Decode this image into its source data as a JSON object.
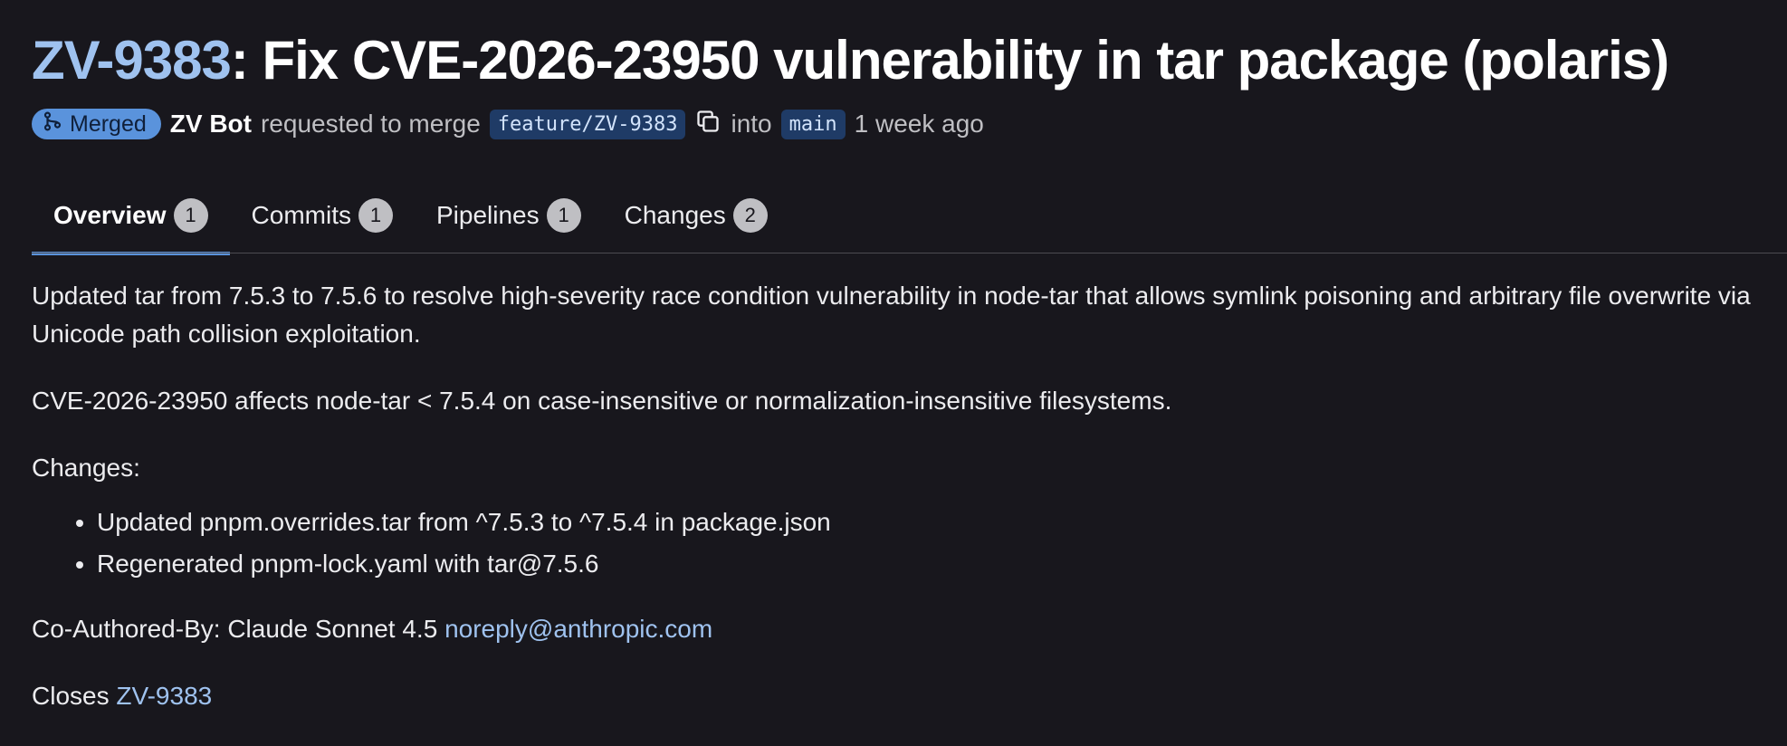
{
  "title": {
    "issue_key": "ZV-9383",
    "text": ": Fix CVE-2026-23950 vulnerability in tar package (polaris)"
  },
  "meta": {
    "status": "Merged",
    "author": "ZV Bot",
    "requested_text": "requested to merge",
    "source_branch": "feature/ZV-9383",
    "into_text": "into",
    "target_branch": "main",
    "time_ago": "1 week ago",
    "copy_icon": "copy-icon",
    "merge_icon": "merge-icon"
  },
  "tabs": [
    {
      "label": "Overview",
      "count": "1",
      "active": true
    },
    {
      "label": "Commits",
      "count": "1",
      "active": false
    },
    {
      "label": "Pipelines",
      "count": "1",
      "active": false
    },
    {
      "label": "Changes",
      "count": "2",
      "active": false
    }
  ],
  "description": {
    "paragraph1": "Updated tar from 7.5.3 to 7.5.6 to resolve high-severity race condition vulnerability in node-tar that allows symlink poisoning and arbitrary file overwrite via Unicode path collision exploitation.",
    "paragraph2": "CVE-2026-23950 affects node-tar < 7.5.4 on case-insensitive or normalization-insensitive filesystems.",
    "changes_heading": "Changes:",
    "changes": [
      "Updated pnpm.overrides.tar from ^7.5.3 to ^7.5.4 in package.json",
      "Regenerated pnpm-lock.yaml with tar@7.5.6"
    ],
    "coauthor_prefix": "Co-Authored-By: Claude Sonnet 4.5 ",
    "coauthor_email": "noreply@anthropic.com",
    "closes_prefix": "Closes ",
    "closes_link": "ZV-9383"
  },
  "colors": {
    "background": "#18171d",
    "link": "#9fc2ef",
    "accent": "#5a93dc",
    "branch_bg": "#1f3b66"
  }
}
